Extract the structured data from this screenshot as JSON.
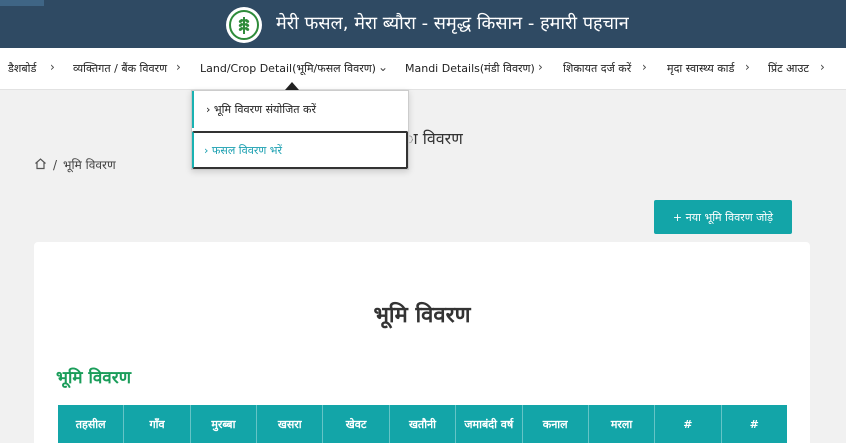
{
  "header": {
    "title": "मेरी फसल, मेरा ब्यौरा - समृद्ध किसान - हमारी पहचान",
    "logo_icon": "wheat-icon"
  },
  "nav": {
    "items": [
      {
        "label": "डैशबोर्ड"
      },
      {
        "label": "व्यक्तिगत / बैंक विवरण"
      },
      {
        "label": "Land/Crop Detail(भूमि/फसल विवरण)"
      },
      {
        "label": "Mandi Details(मंडी विवरण)"
      },
      {
        "label": "शिकायत दर्ज करें"
      },
      {
        "label": "मृदा स्वास्थ्य कार्ड"
      },
      {
        "label": "प्रिंट आउट"
      }
    ]
  },
  "dropdown": {
    "items": [
      {
        "label": "भूमि विवरण संयोजित करें"
      },
      {
        "label": "फसल विवरण भरें"
      }
    ]
  },
  "page": {
    "heading_partial": "ा विवरण",
    "breadcrumb_current": "भूमि विवरण",
    "add_button": "+  नया भूमि विवरण जोड़े",
    "card_title": "भूमि विवरण",
    "section_title": "भूमि विवरण"
  },
  "table": {
    "headers": [
      "तहसील",
      "गाँव",
      "मुरब्बा",
      "खसरा",
      "खेवट",
      "खतौनी",
      "जमाबंदी वर्ष",
      "कनाल",
      "मरला",
      "#",
      "#"
    ]
  },
  "colors": {
    "header_bg": "#2f4a63",
    "accent_teal": "#13a5a8",
    "section_green": "#1a9d5a"
  }
}
